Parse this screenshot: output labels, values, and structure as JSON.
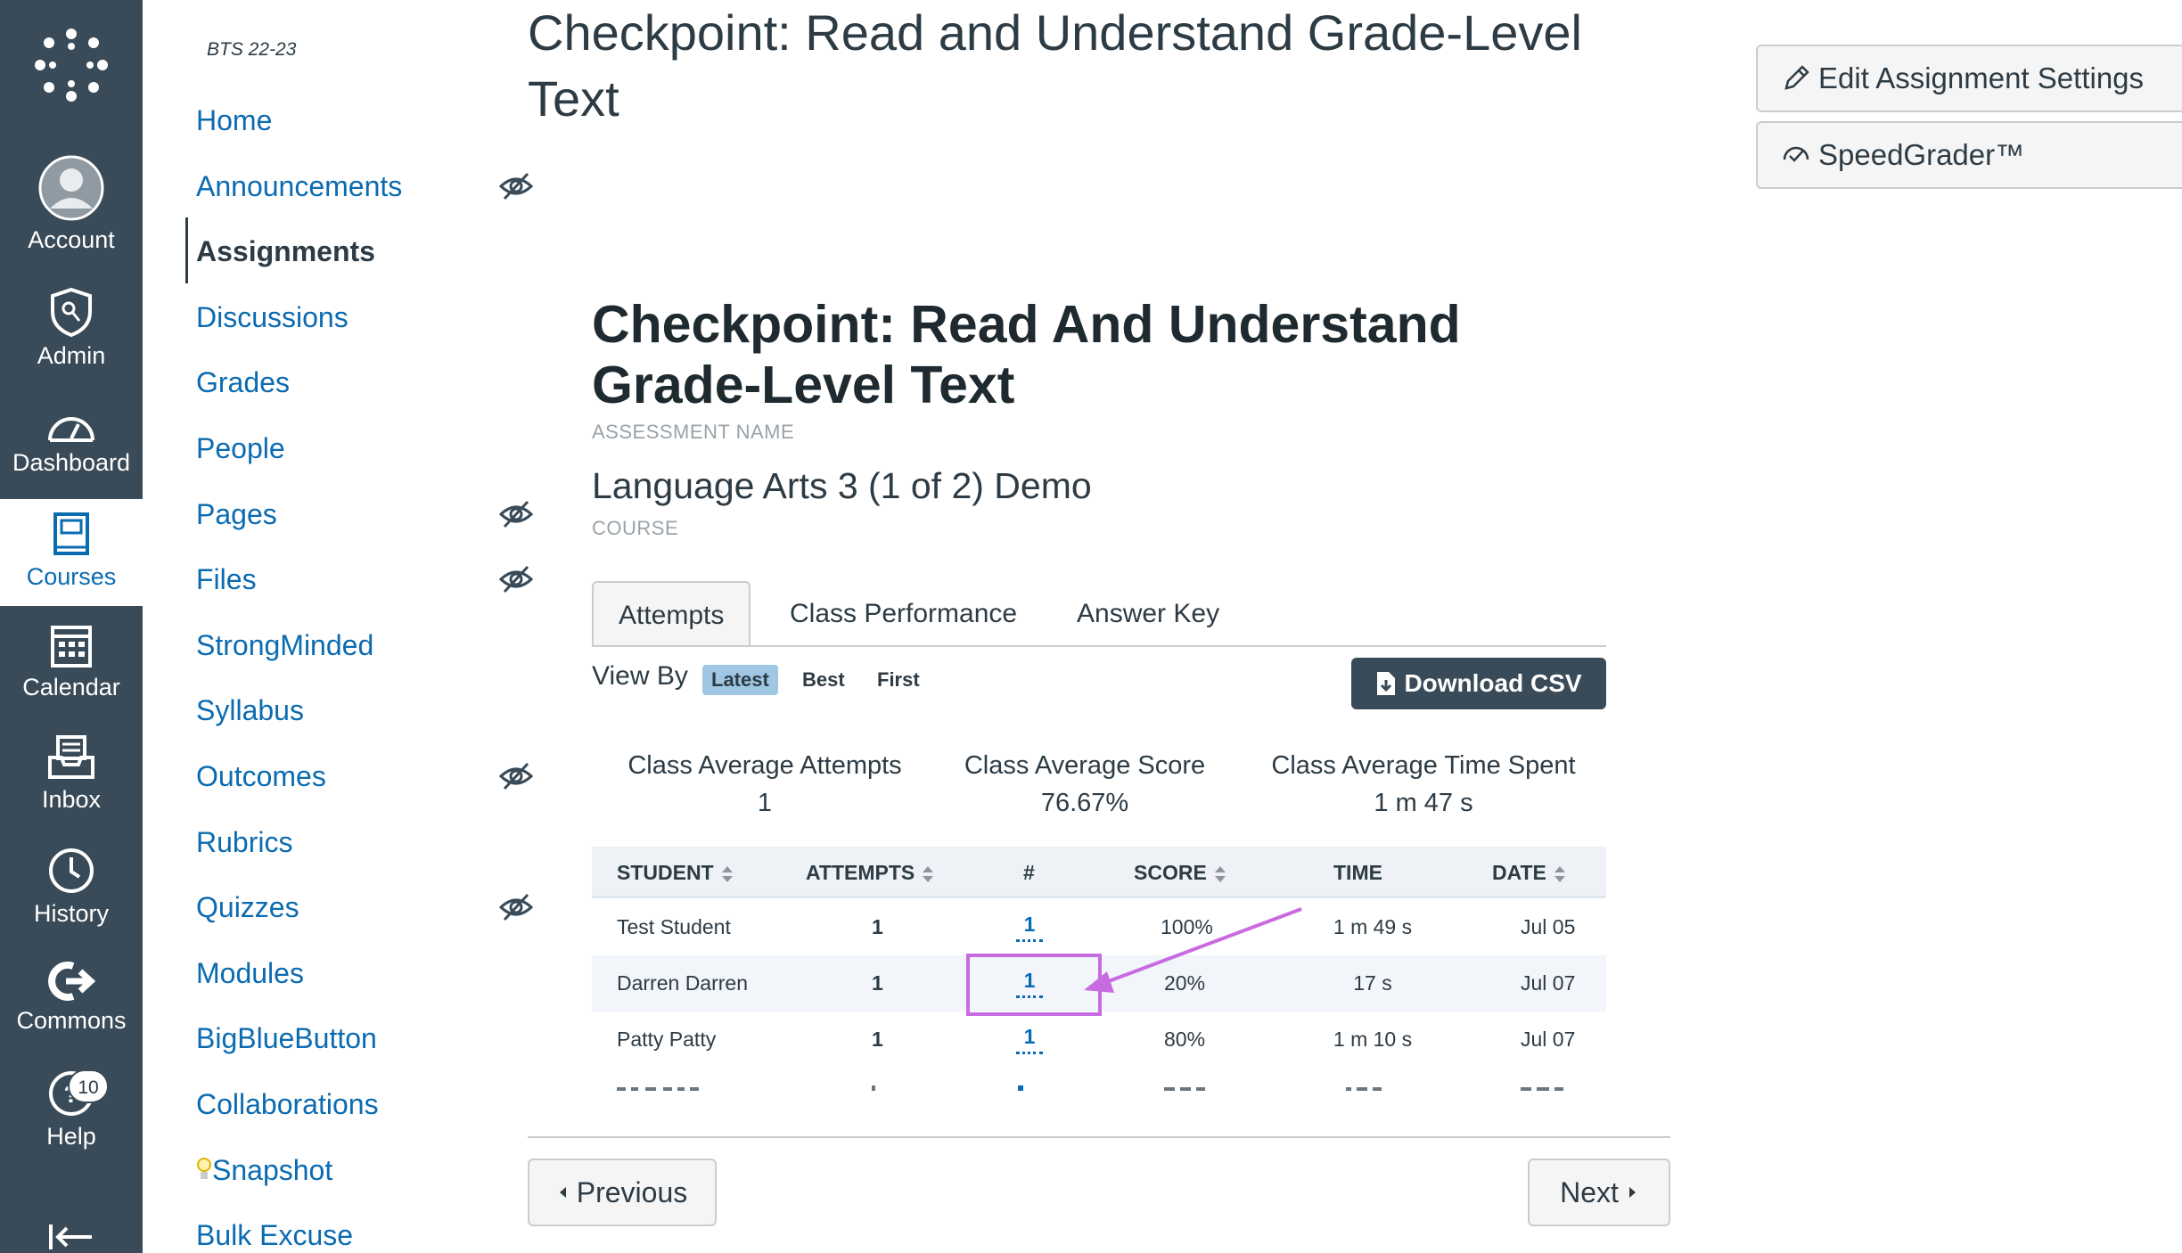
{
  "global_nav": {
    "items": [
      {
        "label": "Account",
        "icon": "account-avatar-icon"
      },
      {
        "label": "Admin",
        "icon": "admin-shield-icon"
      },
      {
        "label": "Dashboard",
        "icon": "dashboard-gauge-icon"
      },
      {
        "label": "Courses",
        "icon": "courses-book-icon",
        "active": true
      },
      {
        "label": "Calendar",
        "icon": "calendar-icon"
      },
      {
        "label": "Inbox",
        "icon": "inbox-icon"
      },
      {
        "label": "History",
        "icon": "history-clock-icon"
      },
      {
        "label": "Commons",
        "icon": "commons-icon"
      },
      {
        "label": "Help",
        "icon": "help-icon",
        "badge": "10"
      }
    ]
  },
  "course_nav": {
    "term": "BTS 22-23",
    "items": [
      {
        "label": "Home"
      },
      {
        "label": "Announcements",
        "hidden": true
      },
      {
        "label": "Assignments",
        "active": true
      },
      {
        "label": "Discussions"
      },
      {
        "label": "Grades"
      },
      {
        "label": "People"
      },
      {
        "label": "Pages",
        "hidden": true
      },
      {
        "label": "Files",
        "hidden": true
      },
      {
        "label": "StrongMinded"
      },
      {
        "label": "Syllabus"
      },
      {
        "label": "Outcomes",
        "hidden": true
      },
      {
        "label": "Rubrics"
      },
      {
        "label": "Quizzes",
        "hidden": true
      },
      {
        "label": "Modules"
      },
      {
        "label": "BigBlueButton"
      },
      {
        "label": "Collaborations"
      },
      {
        "label": "Snapshot"
      },
      {
        "label": "Bulk Excuse"
      }
    ]
  },
  "page_title": "Checkpoint: Read and Understand Grade-Level Text",
  "side_buttons": {
    "edit": "Edit Assignment Settings",
    "speedgrader": "SpeedGrader™"
  },
  "assessment": {
    "name": "Checkpoint: Read And Understand Grade-Level Text",
    "name_label": "ASSESSMENT NAME",
    "course": "Language Arts 3 (1 of 2) Demo",
    "course_label": "COURSE"
  },
  "tabs": [
    "Attempts",
    "Class Performance",
    "Answer Key"
  ],
  "view_by": {
    "label": "View By",
    "options": [
      "Latest",
      "Best",
      "First"
    ],
    "selected": "Latest"
  },
  "download_label": "Download CSV",
  "stats": [
    {
      "label": "Class Average Attempts",
      "value": "1"
    },
    {
      "label": "Class Average Score",
      "value": "76.67%"
    },
    {
      "label": "Class Average Time Spent",
      "value": "1 m 47 s"
    }
  ],
  "table": {
    "headers": [
      "STUDENT",
      "ATTEMPTS",
      "#",
      "SCORE",
      "TIME",
      "DATE"
    ],
    "rows": [
      {
        "student": "Test Student",
        "attempts": "1",
        "num": "1",
        "score": "100%",
        "time": "1 m 49 s",
        "date": "Jul 05"
      },
      {
        "student": "Darren Darren",
        "attempts": "1",
        "num": "1",
        "score": "20%",
        "time": "17 s",
        "date": "Jul 07"
      },
      {
        "student": "Patty Patty",
        "attempts": "1",
        "num": "1",
        "score": "80%",
        "time": "1 m 10 s",
        "date": "Jul 07"
      }
    ]
  },
  "footer": {
    "previous": "Previous",
    "next": "Next"
  },
  "colors": {
    "nav_bg": "#394b58",
    "link": "#0b6bb1",
    "annotation": "#c76ce0",
    "selected_chip": "#9fc7e4"
  }
}
